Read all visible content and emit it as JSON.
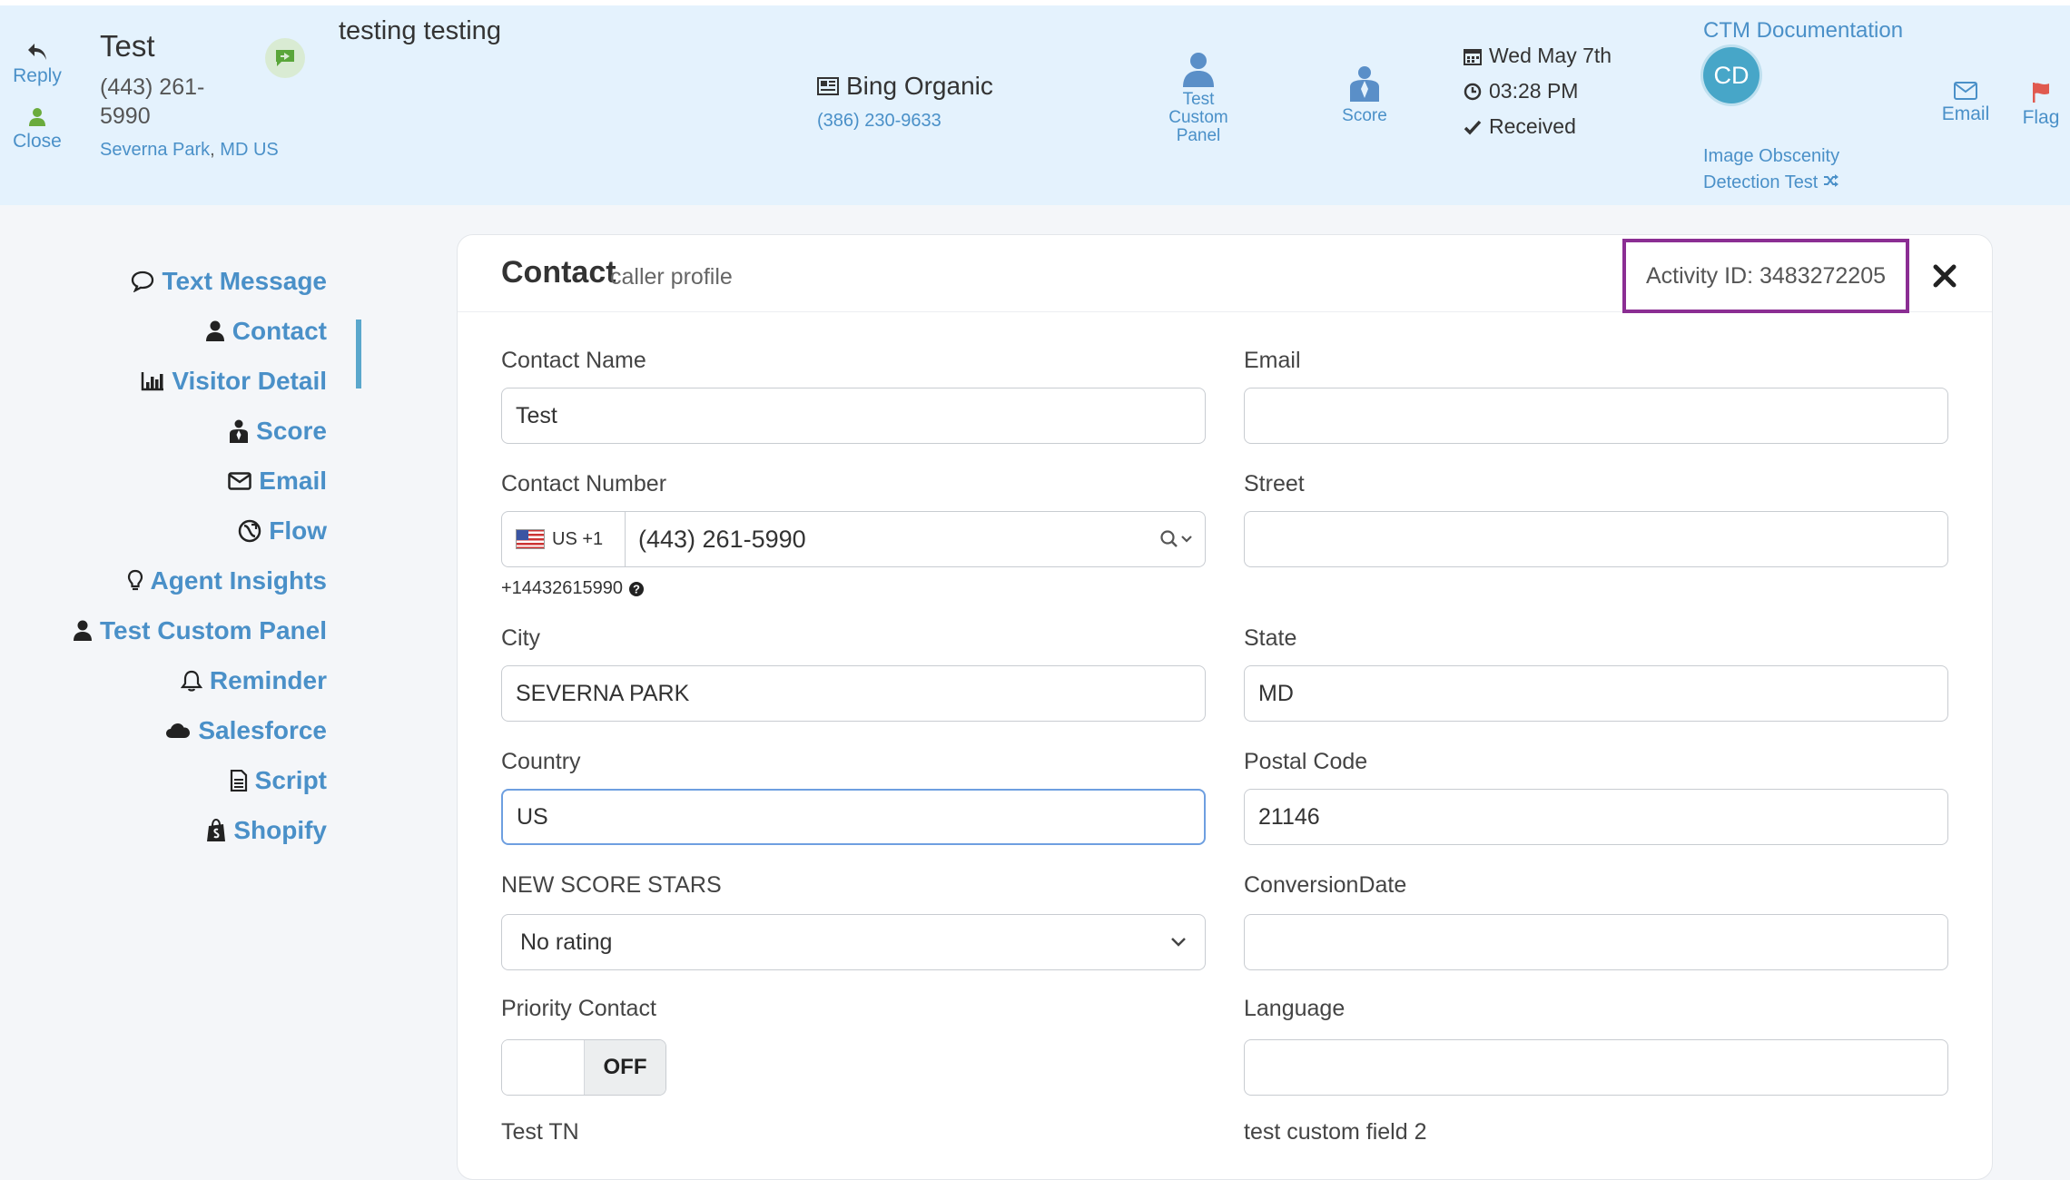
{
  "header": {
    "reply_label": "Reply",
    "close_label": "Close",
    "caller_name": "Test",
    "caller_number": "(443) 261-5990",
    "caller_location_city": "Severna Park",
    "caller_location_sep": ",",
    "caller_location_region": "MD US",
    "notes": "testing testing",
    "source_name": "Bing Organic",
    "tracking_number": "(386) 230-9633",
    "custom_panel_label": "Test Custom Panel",
    "score_label": "Score",
    "date": "Wed May 7th",
    "time": "03:28 PM",
    "status": "Received",
    "ctm_documentation": "CTM Documentation",
    "avatar_initials": "CD",
    "image_test_link": "Image Obscenity Detection Test",
    "email_label": "Email",
    "flag_label": "Flag"
  },
  "nav": {
    "items": [
      {
        "label": "Text Message",
        "icon": "comment-icon"
      },
      {
        "label": "Contact",
        "icon": "user-icon",
        "active": true
      },
      {
        "label": "Visitor Detail",
        "icon": "bar-chart-icon"
      },
      {
        "label": "Score",
        "icon": "score-icon"
      },
      {
        "label": "Email",
        "icon": "envelope-icon"
      },
      {
        "label": "Flow",
        "icon": "flow-icon"
      },
      {
        "label": "Agent Insights",
        "icon": "lightbulb-icon"
      },
      {
        "label": "Test Custom Panel",
        "icon": "user-icon"
      },
      {
        "label": "Reminder",
        "icon": "bell-icon"
      },
      {
        "label": "Salesforce",
        "icon": "cloud-icon"
      },
      {
        "label": "Script",
        "icon": "document-icon"
      },
      {
        "label": "Shopify",
        "icon": "shopping-bag-icon"
      }
    ]
  },
  "card": {
    "title": "Contact",
    "subtitle": "caller profile",
    "activity_id": "Activity ID: 3483272205"
  },
  "form": {
    "contact_name_label": "Contact Name",
    "contact_name_value": "Test",
    "email_label": "Email",
    "email_value": "",
    "contact_number_label": "Contact Number",
    "country_code": "US +1",
    "contact_number_value": "(443) 261-5990",
    "e164": "+14432615990",
    "street_label": "Street",
    "street_value": "",
    "city_label": "City",
    "city_value": "SEVERNA PARK",
    "state_label": "State",
    "state_value": "MD",
    "country_label": "Country",
    "country_value": "US",
    "postal_label": "Postal Code",
    "postal_value": "21146",
    "stars_label": "NEW SCORE STARS",
    "stars_value": "No rating",
    "conversion_label": "ConversionDate",
    "conversion_value": "",
    "priority_label": "Priority Contact",
    "priority_state": "OFF",
    "language_label": "Language",
    "language_value": "",
    "test_tn_label": "Test TN",
    "custom2_label": "test custom field 2"
  },
  "colors": {
    "accent": "#4a90c8",
    "header_bg": "#e4f2fd",
    "highlight_border": "#8b2e93",
    "flag": "#e05a4f"
  }
}
